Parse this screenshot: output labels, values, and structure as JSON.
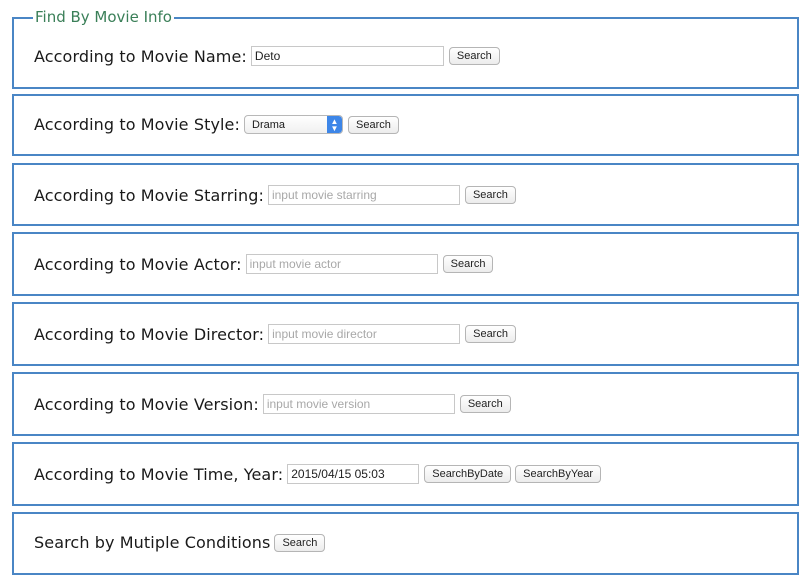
{
  "fieldset": {
    "legend": "Find By Movie Info"
  },
  "by_name": {
    "label": "According to Movie Name:",
    "value": "Deto",
    "button": "Search"
  },
  "by_style": {
    "label": "According to Movie Style:",
    "selected": "Drama",
    "button": "Search"
  },
  "by_starring": {
    "label": "According to Movie Starring:",
    "placeholder": "input movie starring",
    "button": "Search"
  },
  "by_actor": {
    "label": "According to Movie Actor:",
    "placeholder": "input movie actor",
    "button": "Search"
  },
  "by_director": {
    "label": "According to Movie Director:",
    "placeholder": "input movie director",
    "button": "Search"
  },
  "by_version": {
    "label": "According to Movie Version:",
    "placeholder": "input movie version",
    "button": "Search"
  },
  "by_time": {
    "label": "According to Movie Time, Year:",
    "value": "2015/04/15 05:03",
    "button_date": "SearchByDate",
    "button_year": "SearchByYear"
  },
  "multiple": {
    "label": "Search by Mutiple Conditions",
    "button": "Search"
  },
  "colors": {
    "border": "#4a86c5",
    "legend": "#3a7f58",
    "select_accent": "#3d86e8"
  },
  "icons": {
    "select_arrow": "chevron-up-down-icon"
  }
}
